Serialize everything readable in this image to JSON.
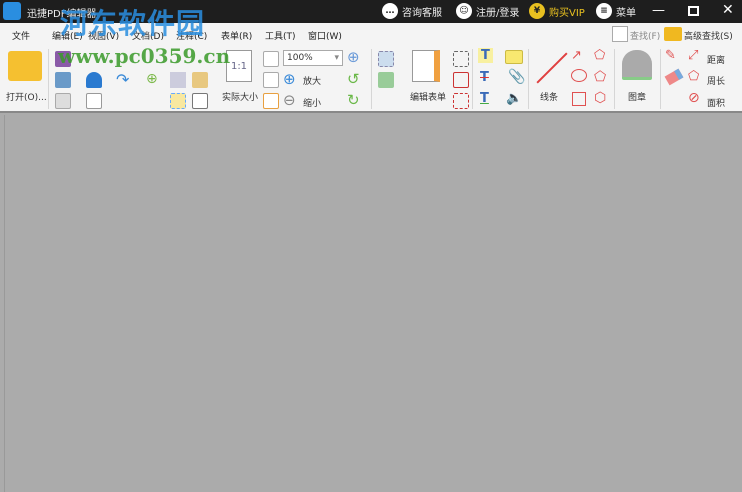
{
  "window": {
    "title": "迅捷PDF编辑器",
    "consult": "咨询客服",
    "login": "注册/登录",
    "vip": "购买VIP",
    "menu": "菜单"
  },
  "menu": [
    "文件",
    "编辑(E)",
    "视图(V)",
    "文档(D)",
    "注释(C)",
    "表单(R)",
    "工具(T)",
    "窗口(W)"
  ],
  "toolbar": {
    "open": "打开(O)...",
    "actual_size": "实际大小",
    "zoom_value": "100%",
    "zoom_in": "放大",
    "zoom_out": "缩小",
    "edit_form": "编辑表单",
    "line": "线条",
    "stamp": "图章",
    "distance": "距离",
    "perimeter": "周长",
    "area": "面积",
    "find": "查找(F)",
    "advanced_find": "高级查找(S)",
    "actual_icon_text": "1:1"
  },
  "watermark": {
    "name": "河东软件园",
    "url": "www.pc0359.cn"
  },
  "colors": {
    "titlebar": "#1e1e1e",
    "toolbar": "#f4f4f4",
    "workspace": "#ababab",
    "vip": "#e8c020"
  }
}
